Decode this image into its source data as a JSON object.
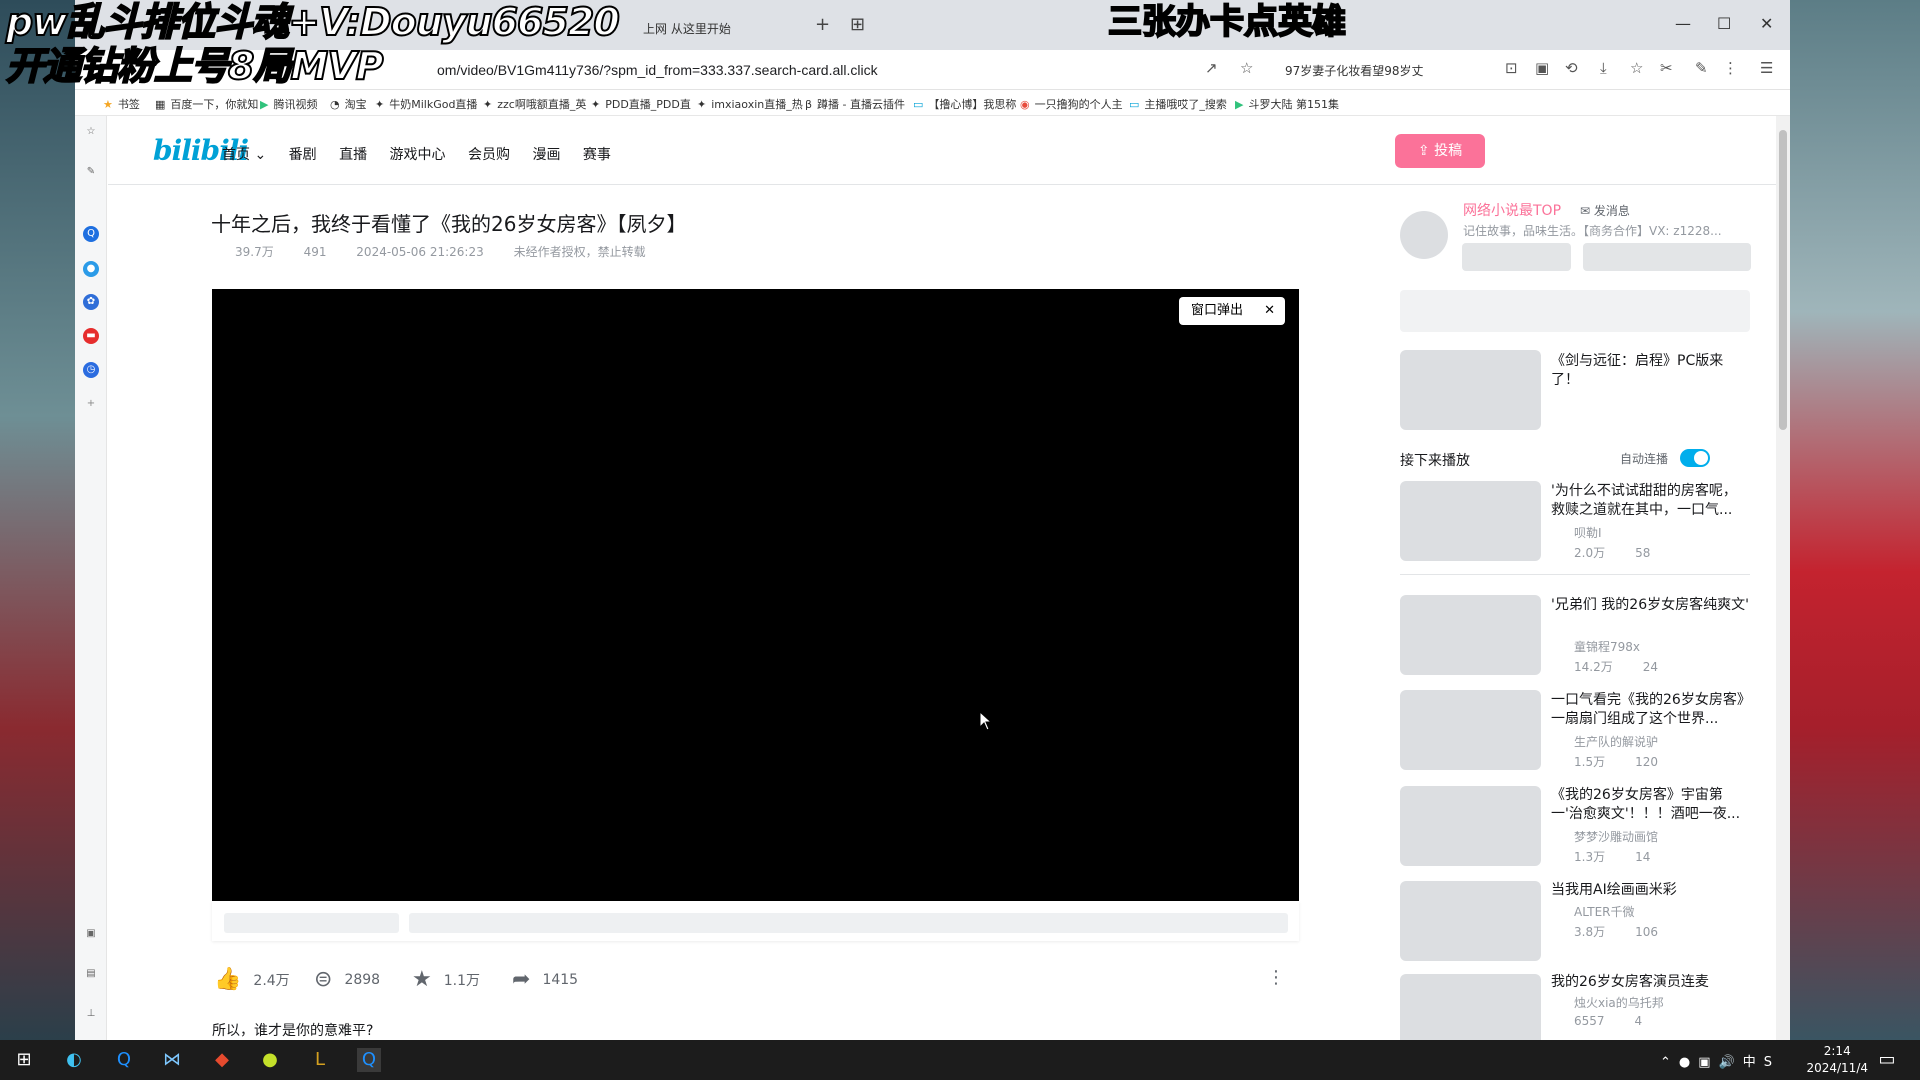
{
  "browser": {
    "tab_title": "上网 从这里开始",
    "url": "om/video/BV1Gm411y736/?spm_id_from=333.337.search-card.all.click",
    "ext_site": "97岁妻子化妆看望98岁丈"
  },
  "bookmarks": [
    "书签",
    "百度一下，你就知",
    "腾讯视频",
    "淘宝",
    "牛奶MilkGod直播",
    "zzc啊哦额直播_英",
    "PDD直播_PDD直",
    "imxiaoxin直播_热",
    "蹲播 - 直播云插件",
    "【撸心博】我思称",
    "一只撸狗的个人主",
    "主播哦哎了_搜索",
    "斗罗大陆 第151集"
  ],
  "nav": {
    "items": [
      "首页",
      "番剧",
      "直播",
      "游戏中心",
      "会员购",
      "漫画",
      "赛事"
    ],
    "upload": "投稿",
    "logo": "bilibili"
  },
  "video": {
    "title": "十年之后，我终于看懂了《我的26岁女房客》【夙夕】",
    "views": "39.7万",
    "danmaku": "491",
    "date": "2024-05-06 21:26:23",
    "notice": "未经作者授权，禁止转载",
    "popout": "窗口弹出",
    "desc": "所以，谁才是你的意难平?"
  },
  "actions": {
    "like": "2.4万",
    "coin": "2898",
    "fav": "1.1万",
    "share": "1415"
  },
  "author": {
    "name": "网络小说最TOP",
    "msg": "发消息",
    "sig": "记住故事，品味生活。【商务合作】VX: z1228..."
  },
  "ad": {
    "title": "《剑与远征：启程》PC版来了！"
  },
  "next": {
    "heading": "接下来播放",
    "autoplay": "自动连播"
  },
  "recs": [
    {
      "title": "'为什么不试试甜甜的房客呢，救赎之道就在其中，一口气...",
      "up": "呗勒I",
      "views": "2.0万",
      "dm": "58"
    },
    {
      "title": "'兄弟们 我的26岁女房客纯爽文'",
      "up": "童锦程798x",
      "views": "14.2万",
      "dm": "24"
    },
    {
      "title": "一口气看完《我的26岁女房客》一扇扇门组成了这个世界...",
      "up": "生产队的解说驴",
      "views": "1.5万",
      "dm": "120"
    },
    {
      "title": "《我的26岁女房客》宇宙第一'治愈爽文'！！！酒吧一夜...",
      "up": "梦梦沙雕动画馆",
      "views": "1.3万",
      "dm": "14"
    },
    {
      "title": "当我用AI绘画画米彩",
      "up": "ALTER千微",
      "views": "3.8万",
      "dm": "106"
    },
    {
      "title": "我的26岁女房客演员连麦",
      "up": "烛火xia的乌托邦",
      "views": "6557",
      "dm": "4"
    }
  ],
  "overlay": {
    "line1": "pw乱斗排位斗魂+V:Douyu66520",
    "line2": "开通钻粉上号8局MVP",
    "right": "三张办卡点英雄"
  },
  "taskbar": {
    "time": "2:14",
    "date": "2024/11/4",
    "ime": "中"
  }
}
